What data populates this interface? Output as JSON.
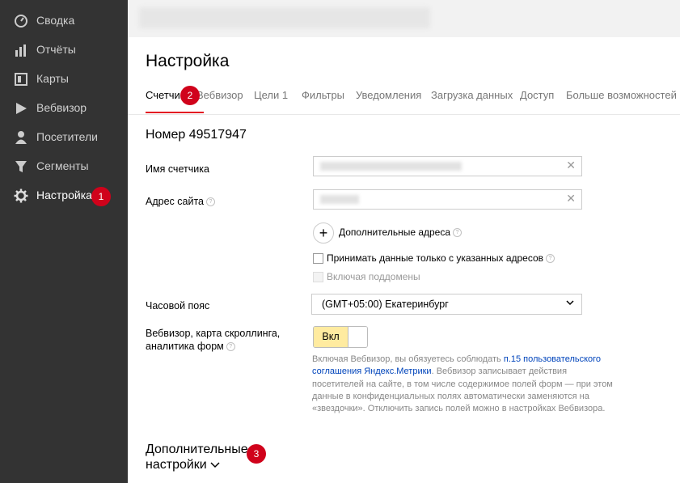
{
  "sidebar": {
    "items": [
      {
        "label": "Сводка",
        "icon": "gauge-icon"
      },
      {
        "label": "Отчёты",
        "icon": "bar-chart-icon"
      },
      {
        "label": "Карты",
        "icon": "map-icon"
      },
      {
        "label": "Вебвизор",
        "icon": "play-icon"
      },
      {
        "label": "Посетители",
        "icon": "person-icon"
      },
      {
        "label": "Сегменты",
        "icon": "filter-icon"
      },
      {
        "label": "Настройка",
        "icon": "gear-icon"
      }
    ]
  },
  "annotations": {
    "one": "1",
    "two": "2",
    "three": "3"
  },
  "page": {
    "title": "Настройка"
  },
  "tabs": [
    {
      "label": "Счетчик"
    },
    {
      "label": "Вебвизор"
    },
    {
      "label": "Цели 1"
    },
    {
      "label": "Фильтры"
    },
    {
      "label": "Уведомления"
    },
    {
      "label": "Загрузка данных"
    },
    {
      "label": "Доступ"
    },
    {
      "label": "Больше возможностей"
    }
  ],
  "counter": {
    "title": "Номер 49517947",
    "name_label": "Имя счетчика",
    "site_label": "Адрес сайта",
    "extra_addresses": "Дополнительные адреса",
    "only_listed": "Принимать данные только с указанных адресов",
    "include_subdomains": "Включая поддомены",
    "timezone_label": "Часовой пояс",
    "timezone_value": "(GMT+05:00) Екатеринбург",
    "webvisor_label_1": "Вебвизор, карта скроллинга,",
    "webvisor_label_2": "аналитика форм",
    "toggle_on": "Вкл",
    "note_1": "Включая Вебвизор, вы обязуетесь соблюдать ",
    "note_link": "п.15 пользовательского соглашения Яндекс.Метрики",
    "note_2": ". Вебвизор записывает действия посетителей на сайте, в том числе содержимое полей форм — при этом данные в конфиденциальных полях автоматически заменяются на «звездочки». Отключить запись полей можно в настройках Вебвизора.",
    "more_1": "Дополнительные",
    "more_2": "настройки"
  },
  "colors": {
    "accent": "#e31b23",
    "sidebar": "#333333",
    "toggle_on": "#ffeba0",
    "badge": "#d0021b",
    "link": "#0044bb"
  }
}
